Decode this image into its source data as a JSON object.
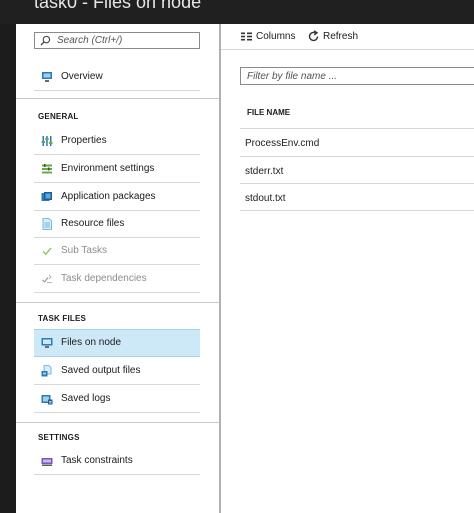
{
  "window": {
    "title": "task0 - Files on node"
  },
  "sidebar": {
    "search_placeholder": "Search (Ctrl+/)",
    "overview": {
      "label": "Overview",
      "icon": "overview-icon"
    },
    "sections": [
      {
        "header": "GENERAL",
        "items": [
          {
            "label": "Properties",
            "icon": "properties-icon",
            "disabled": false
          },
          {
            "label": "Environment settings",
            "icon": "environment-icon",
            "disabled": false
          },
          {
            "label": "Application packages",
            "icon": "packages-icon",
            "disabled": false
          },
          {
            "label": "Resource files",
            "icon": "resource-files-icon",
            "disabled": false
          },
          {
            "label": "Sub Tasks",
            "icon": "check-icon",
            "disabled": true
          },
          {
            "label": "Task dependencies",
            "icon": "dependencies-icon",
            "disabled": true
          }
        ]
      },
      {
        "header": "TASK FILES",
        "items": [
          {
            "label": "Files on node",
            "icon": "node-files-icon",
            "active": true
          },
          {
            "label": "Saved output files",
            "icon": "saved-output-icon"
          },
          {
            "label": "Saved logs",
            "icon": "saved-logs-icon"
          }
        ]
      },
      {
        "header": "SETTINGS",
        "items": [
          {
            "label": "Task constraints",
            "icon": "constraints-icon"
          }
        ]
      }
    ]
  },
  "toolbar": {
    "columns_label": "Columns",
    "refresh_label": "Refresh"
  },
  "files": {
    "filter_placeholder": "Filter by file name ...",
    "column_header": "FILE NAME",
    "rows": [
      "ProcessEnv.cmd",
      "stderr.txt",
      "stdout.txt"
    ]
  },
  "colors": {
    "active_bg": "#cde8f7",
    "chrome_dark": "#1c1c1c",
    "icon_blue": "#2a7ab8",
    "icon_green": "#6aa84f"
  }
}
